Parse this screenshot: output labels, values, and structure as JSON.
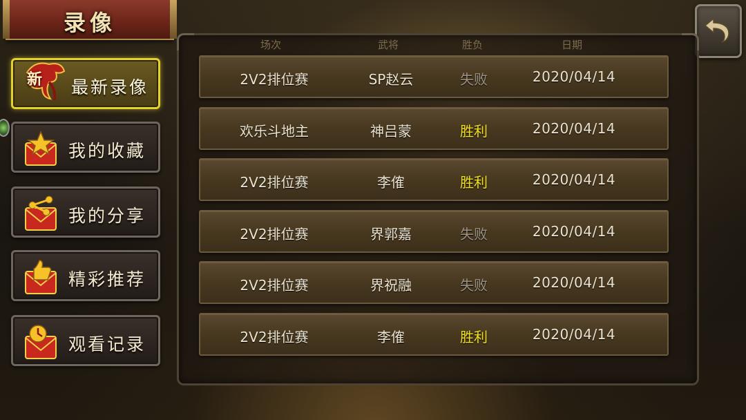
{
  "title": "录像",
  "sidebar": {
    "items": [
      {
        "label": "最新录像",
        "icon": "new-badge-icon",
        "badge": "新",
        "active": true
      },
      {
        "label": "我的收藏",
        "icon": "star-envelope-icon",
        "active": false
      },
      {
        "label": "我的分享",
        "icon": "share-envelope-icon",
        "active": false
      },
      {
        "label": "精彩推荐",
        "icon": "thumbs-up-envelope-icon",
        "active": false
      },
      {
        "label": "观看记录",
        "icon": "clock-envelope-icon",
        "active": false
      }
    ]
  },
  "table": {
    "headers": {
      "mode": "场次",
      "hero": "武将",
      "result": "胜负",
      "date": "日期"
    },
    "rows": [
      {
        "mode": "2V2排位赛",
        "hero": "SP赵云",
        "result": "失败",
        "date": "2020/04/14"
      },
      {
        "mode": "欢乐斗地主",
        "hero": "神吕蒙",
        "result": "胜利",
        "date": "2020/04/14"
      },
      {
        "mode": "2V2排位赛",
        "hero": "李傕",
        "result": "胜利",
        "date": "2020/04/14"
      },
      {
        "mode": "2V2排位赛",
        "hero": "界郭嘉",
        "result": "失败",
        "date": "2020/04/14"
      },
      {
        "mode": "2V2排位赛",
        "hero": "界祝融",
        "result": "失败",
        "date": "2020/04/14"
      },
      {
        "mode": "2V2排位赛",
        "hero": "李傕",
        "result": "胜利",
        "date": "2020/04/14"
      }
    ]
  },
  "colors": {
    "win": "#f2e01e",
    "lose": "#9a9282",
    "active_border": "#e3d22c"
  },
  "back_button": {
    "icon": "back-arrow-icon"
  }
}
